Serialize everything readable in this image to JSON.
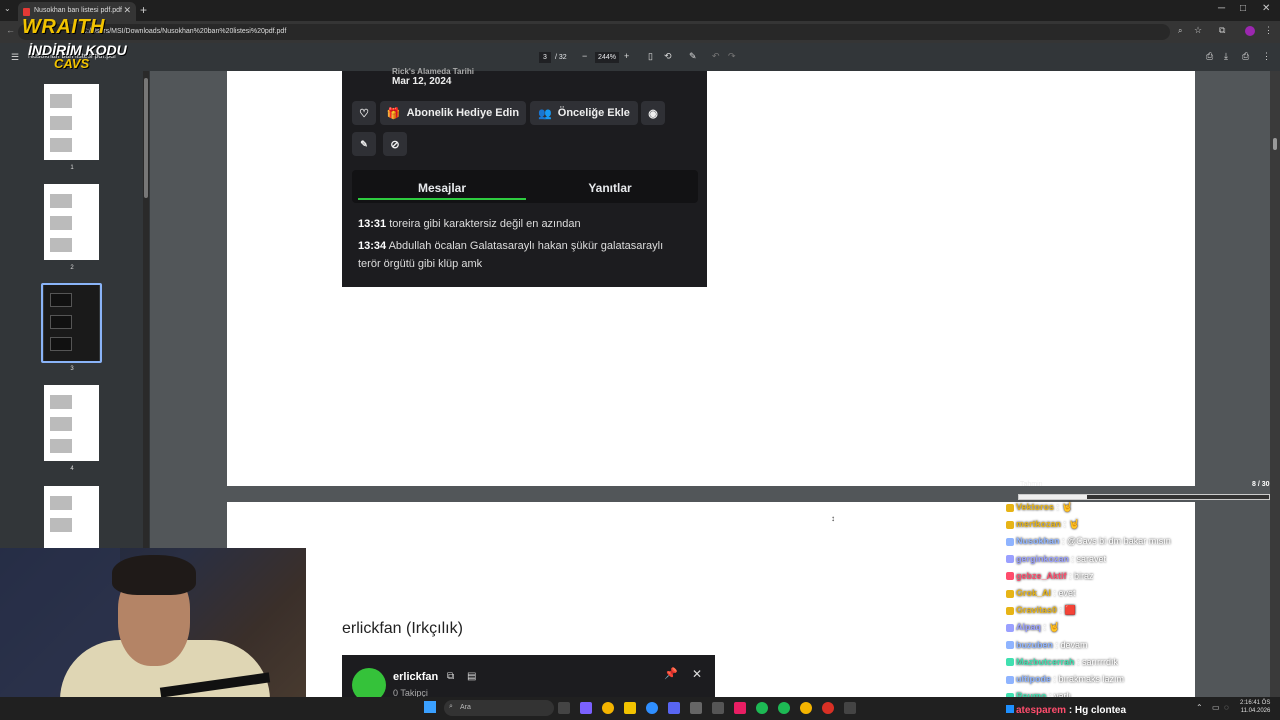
{
  "browser": {
    "tab_title": "Nusokhan ban listesi pdf.pdf",
    "url": "C:/Users/MSI/Downloads/Nusokhan%20ban%20listesi%20pdf.pdf",
    "new_tab_icon": "plus-icon",
    "window_controls": [
      "─",
      "□",
      "✕"
    ]
  },
  "pdf_toolbar": {
    "file_name": "Nusokhan ban listesi pdf.pdf",
    "current_page": "3",
    "page_count": "/ 32",
    "zoom": "244%"
  },
  "sidebar": {
    "thumbnails": [
      {
        "label": "1"
      },
      {
        "label": "2"
      },
      {
        "label": "3"
      },
      {
        "label": "4"
      }
    ]
  },
  "page1": {
    "date_label": "Rick's Alameda Tarihi",
    "date": "Mar 12, 2024",
    "gift_button": "Abonelik Hediye Edin",
    "priority_button": "Önceliğe Ekle",
    "tabs": {
      "messages": "Mesajlar",
      "replies": "Yanıtlar"
    },
    "messages": [
      {
        "time": "13:31",
        "text": "toreira gibi karaktersiz değil en azından"
      },
      {
        "time": "13:34",
        "text": "Abdullah öcalan Galatasaraylı hakan şükür galatasaraylı terör örgütü gibi klüp amk"
      }
    ]
  },
  "page2": {
    "title": "erlickfan (Irkçılık)",
    "user": "erlickfan",
    "followers": "0 Takipçi"
  },
  "overlay": {
    "brand": "WRAITH",
    "promo": "İNDİRİM KODU",
    "code": "CAVS"
  },
  "chat_overlay": {
    "label": "Tahmin",
    "counter": "8 / 30",
    "progress": 0.27,
    "messages": [
      {
        "user": "Vektoros",
        "text": ": 🤘",
        "color": "#e7b416"
      },
      {
        "user": "mertkozan",
        "text": ": 🤘",
        "color": "#e7b416"
      },
      {
        "user": "Nusokhan",
        "text": ": @Cavs bi dm bakar mısın",
        "color": "#8fb4ff"
      },
      {
        "user": "gerginkozan",
        "text": ": saravet",
        "color": "#9aa0ff"
      },
      {
        "user": "gebze_Aktif",
        "text": ": biraz",
        "color": "#ff4d6d"
      },
      {
        "user": "Grok_AI",
        "text": ": evet",
        "color": "#e7b416"
      },
      {
        "user": "Gravitas0",
        "text": ": 🟥",
        "color": "#e7b416"
      },
      {
        "user": "Alpaq",
        "text": ": 🤘",
        "color": "#9aa0ff"
      },
      {
        "user": "buzuben",
        "text": ": devam",
        "color": "#8fb4ff"
      },
      {
        "user": "Mazbutcerrah",
        "text": ": sarırrrdık",
        "color": "#40e0b0"
      },
      {
        "user": "ultipode",
        "text": ": bırakmaks lazım",
        "color": "#8fb4ff"
      },
      {
        "user": "Reumo",
        "text": ": yarlı",
        "color": "#40e0b0"
      }
    ],
    "bottom_message": {
      "user": "atesparem",
      "text": ": Hg clontea",
      "color": "#ff4d6d"
    }
  },
  "taskbar": {
    "search_placeholder": "Ara",
    "time": "2:16:41 ÖS",
    "date": "11.04.2026"
  }
}
